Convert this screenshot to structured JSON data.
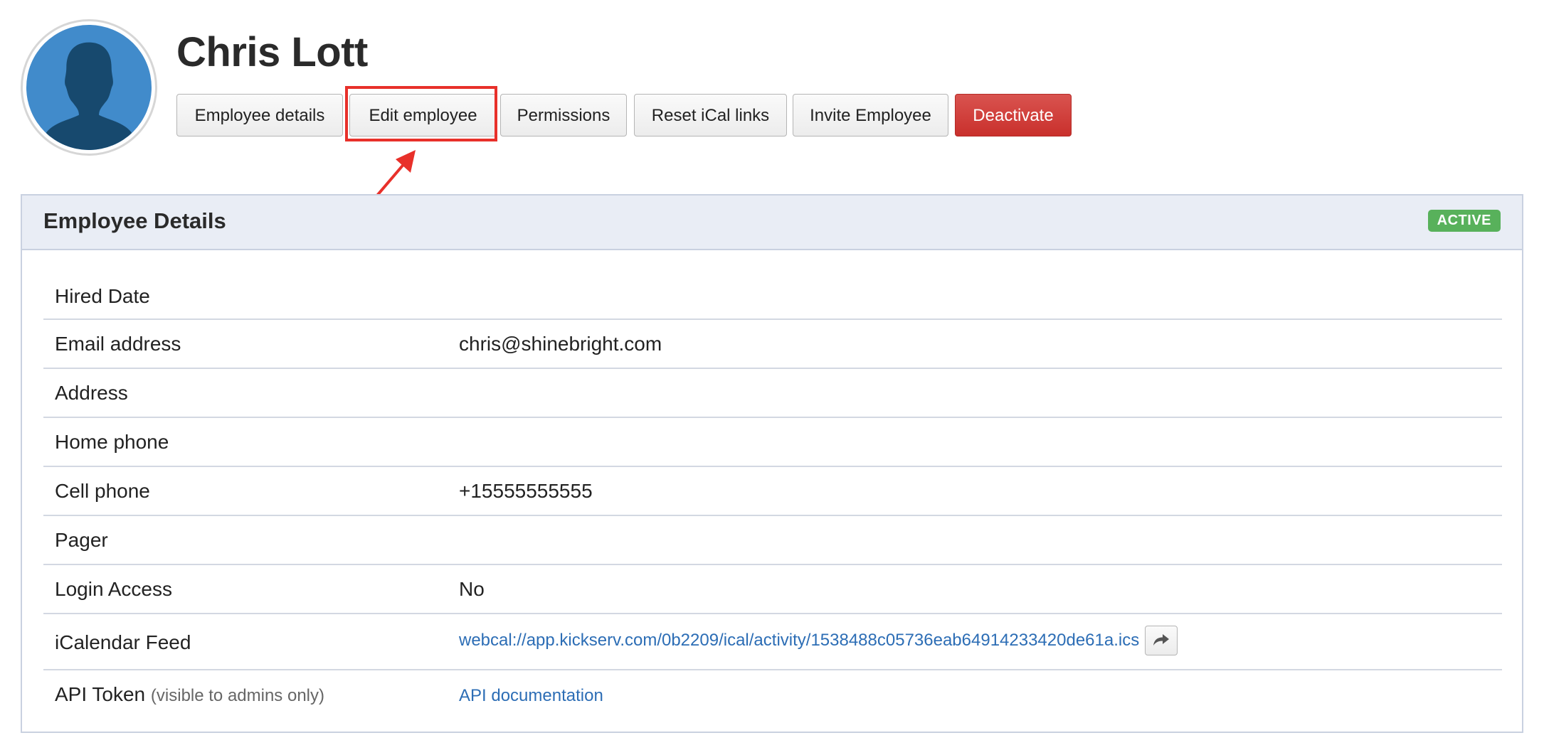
{
  "employee": {
    "name": "Chris Lott"
  },
  "toolbar": {
    "buttons": [
      {
        "label": "Employee details"
      },
      {
        "label": "Edit employee"
      },
      {
        "label": "Permissions"
      },
      {
        "label": "Reset iCal links"
      },
      {
        "label": "Invite Employee"
      },
      {
        "label": "Deactivate"
      }
    ],
    "highlighted": "Edit employee"
  },
  "panel": {
    "title": "Employee Details",
    "status_badge": "ACTIVE",
    "rows": [
      {
        "label": "Hired Date",
        "value": ""
      },
      {
        "label": "Email address",
        "value": "chris@shinebright.com"
      },
      {
        "label": "Address",
        "value": ""
      },
      {
        "label": "Home phone",
        "value": ""
      },
      {
        "label": "Cell phone",
        "value": "+15555555555"
      },
      {
        "label": "Pager",
        "value": ""
      },
      {
        "label": "Login Access",
        "value": "No"
      },
      {
        "label": "iCalendar Feed",
        "value": "webcal://app.kickserv.com/0b2209/ical/activity/1538488c05736eab64914233420de61a.ics",
        "action_icon": "share-arrow-icon"
      },
      {
        "label": "API Token",
        "note": "(visible to admins only)",
        "value": "API documentation"
      }
    ]
  },
  "colors": {
    "accent_link": "#2c6db5",
    "danger": "#d9534f",
    "active_badge": "#58b15b",
    "annotation": "#e8302a",
    "panel_header_bg": "#e9edf5"
  }
}
